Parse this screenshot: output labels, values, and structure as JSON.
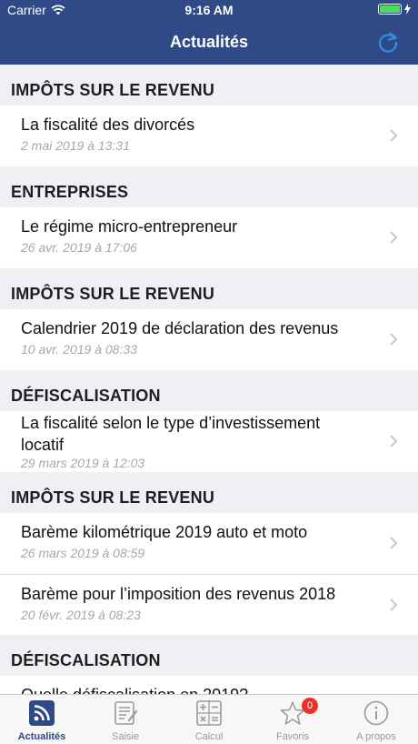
{
  "status_bar": {
    "carrier": "Carrier",
    "time": "9:16 AM"
  },
  "nav": {
    "title": "Actualités"
  },
  "sections": [
    {
      "header": "IMPÔTS SUR LE REVENU",
      "items": [
        {
          "title": "La fiscalité des divorcés",
          "date": "2 mai 2019 à 13:31"
        }
      ]
    },
    {
      "header": "ENTREPRISES",
      "items": [
        {
          "title": "Le régime micro-entrepreneur",
          "date": "26 avr. 2019 à 17:06"
        }
      ]
    },
    {
      "header": "IMPÔTS SUR LE REVENU",
      "items": [
        {
          "title": "Calendrier 2019 de déclaration des revenus",
          "date": "10 avr. 2019 à 08:33"
        }
      ]
    },
    {
      "header": "DÉFISCALISATION",
      "items": [
        {
          "title": "La fiscalité selon le type d’investissement locatif",
          "date": "29 mars 2019 à 12:03"
        }
      ]
    },
    {
      "header": "IMPÔTS SUR LE REVENU",
      "items": [
        {
          "title": "Barème kilométrique 2019 auto et moto",
          "date": "26 mars 2019 à 08:59"
        },
        {
          "title": "Barème pour l’imposition des revenus 2018",
          "date": "20 févr. 2019 à 08:23"
        }
      ]
    },
    {
      "header": "DÉFISCALISATION",
      "items": [
        {
          "title": "Quelle défiscalisation en 2019?",
          "date": ""
        }
      ]
    }
  ],
  "tabbar": {
    "tabs": [
      {
        "label": "Actualités",
        "icon": "rss-icon"
      },
      {
        "label": "Saisie",
        "icon": "form-icon"
      },
      {
        "label": "Calcul",
        "icon": "calculator-icon"
      },
      {
        "label": "Favoris",
        "icon": "star-icon",
        "badge": "0"
      },
      {
        "label": "A propos",
        "icon": "info-icon"
      }
    ]
  },
  "colors": {
    "nav_bg": "#2f4a86",
    "refresh": "#2f8ee0",
    "badge": "#e8322b",
    "battery": "#4cd964"
  }
}
